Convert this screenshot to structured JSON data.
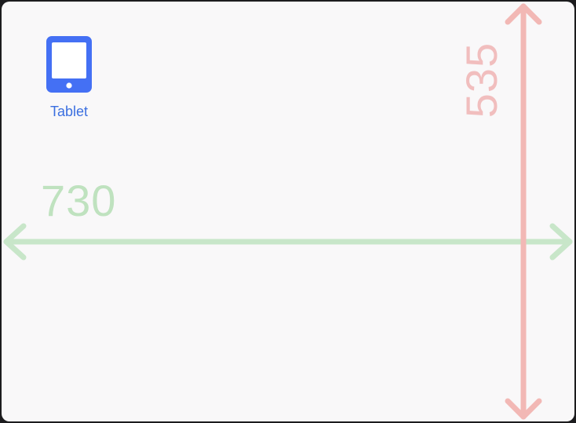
{
  "devices": [
    {
      "label": "Tablet",
      "icon": "tablet-icon"
    }
  ],
  "overlay": {
    "width_value": "730",
    "height_value": "535",
    "width_arrow_color": "#c8e6c9",
    "height_arrow_color": "#f2b8b5"
  },
  "colors": {
    "accent": "#4470f4",
    "background": "#f9f8f9"
  }
}
